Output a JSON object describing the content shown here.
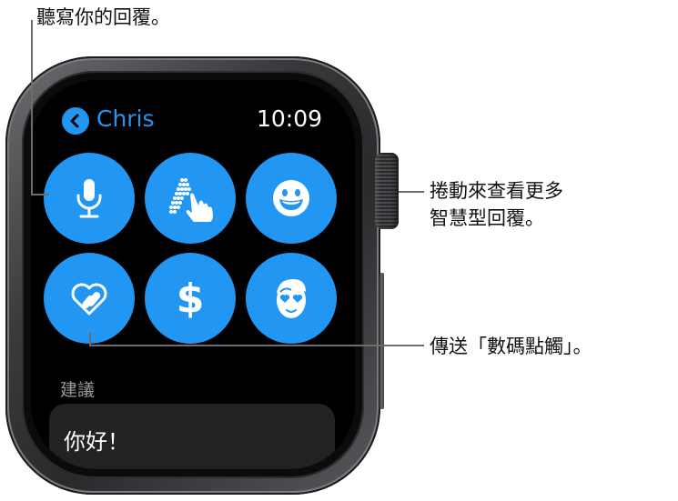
{
  "callouts": {
    "dictate": "聽寫你的回覆。",
    "scroll_line1": "捲動來查看更多",
    "scroll_line2": "智慧型回覆。",
    "digital_touch": "傳送「數碼點觸」。"
  },
  "watch": {
    "header": {
      "back_icon": "chevron-left-icon",
      "contact_name": "Chris",
      "time": "10:09"
    },
    "reply_buttons": [
      {
        "name": "dictation-button",
        "icon": "microphone-icon"
      },
      {
        "name": "scribble-button",
        "icon": "scribble-hand-icon"
      },
      {
        "name": "emoji-button",
        "icon": "smiley-icon"
      },
      {
        "name": "digital-touch-button",
        "icon": "heart-touch-icon"
      },
      {
        "name": "apple-pay-button",
        "icon": "dollar-icon",
        "label": "$"
      },
      {
        "name": "memoji-button",
        "icon": "memoji-heart-eyes-icon"
      }
    ],
    "suggestions": {
      "label": "建議",
      "items": [
        "你好！"
      ]
    }
  },
  "colors": {
    "accent": "#2196f3",
    "screen_bg": "#000000",
    "card_bg": "#222222",
    "callout_line": "#6d6d6d"
  }
}
